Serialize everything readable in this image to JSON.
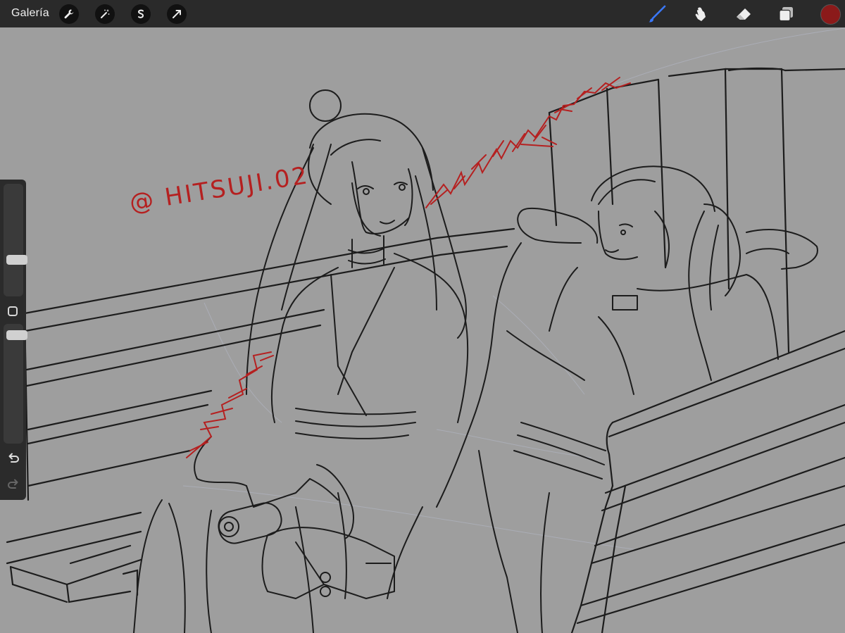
{
  "app": {
    "gallery_label": "Galería"
  },
  "toolbar": {
    "left_tools": [
      "wrench-icon",
      "magic-wand-icon",
      "selection-icon",
      "transform-arrow-icon"
    ],
    "right_tools": [
      "brush-icon",
      "smudge-icon",
      "eraser-icon",
      "layers-icon"
    ],
    "current_color": "#8b1a1a",
    "active_tool": "brush",
    "active_tool_color": "#3a78ff"
  },
  "sidebar": {
    "brush_size_level": 0.3,
    "opacity_level": 0.95,
    "undo_icon": "undo-arrow-icon",
    "redo_icon": "redo-arrow-icon"
  },
  "canvas": {
    "background_color": "#9e9e9e",
    "line_color": "#1c1c1c",
    "annotation_color": "#b52020",
    "watermark_text": "@ HITSUJI.02"
  }
}
